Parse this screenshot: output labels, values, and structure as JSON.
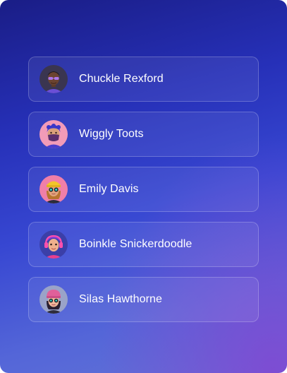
{
  "users": [
    {
      "name": "Chuckle Rexford",
      "avatar_icon": "avatar-chuckle-rexford-icon",
      "avatar_bg": "#3a3550"
    },
    {
      "name": "Wiggly Toots",
      "avatar_icon": "avatar-wiggly-toots-icon",
      "avatar_bg": "#f29bb8"
    },
    {
      "name": "Emily Davis",
      "avatar_icon": "avatar-emily-davis-icon",
      "avatar_bg": "#f07fa8"
    },
    {
      "name": "Boinkle Snickerdoodle",
      "avatar_icon": "avatar-boinkle-snickerdoodle-icon",
      "avatar_bg": "#3b3fa8"
    },
    {
      "name": "Silas Hawthorne",
      "avatar_icon": "avatar-silas-hawthorne-icon",
      "avatar_bg": "#9aa3c8"
    }
  ],
  "colors": {
    "panel_top": "#1a1d86",
    "panel_bottom": "#6373d6",
    "accent_corner": "#8246d2",
    "text": "#ffffff"
  }
}
